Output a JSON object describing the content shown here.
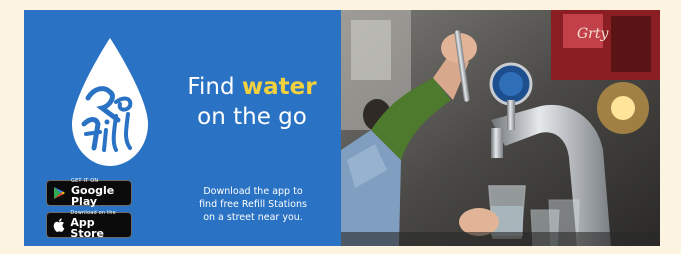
{
  "headline": {
    "line1_prefix": "Find",
    "line1_accent": "water",
    "line2": "on the go"
  },
  "tagline": {
    "line1": "Download the app to",
    "line2": "find free Refill Stations",
    "line3": "on a street near you."
  },
  "logo": {
    "text": "Refill",
    "icon": "water-drop-icon"
  },
  "badges": {
    "google_play": {
      "small": "GET IT ON",
      "big": "Google Play",
      "icon": "google-play-icon"
    },
    "app_store": {
      "small": "Download on the",
      "big": "App Store",
      "icon": "apple-icon"
    }
  },
  "photo": {
    "description_icon": "water-tap-photo"
  },
  "colors": {
    "brand_blue": "#2a72c4",
    "accent_yellow": "#f3d03e",
    "background": "#fdf3e1"
  }
}
